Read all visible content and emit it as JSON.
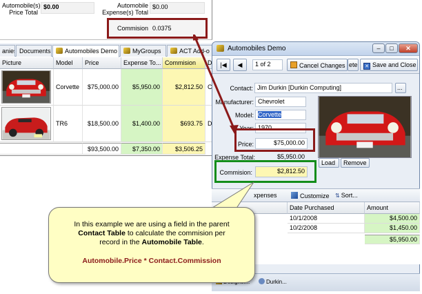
{
  "top_fields": {
    "automobile_price_total_label_1": "Automobile(s)",
    "automobile_price_total_label_2": "Price Total",
    "automobile_price_total_value": "$0.00",
    "automobile_expense_total_label_1": "Automobile",
    "automobile_expense_total_label_2": "Expense(s) Total",
    "automobile_expense_total_value": "$0.00",
    "commission_label": "Commision",
    "commission_value": "0.0375"
  },
  "tabs": [
    {
      "label": "anies"
    },
    {
      "label": "Documents"
    },
    {
      "label": "Automobiles Demo",
      "icon": "folder-icon"
    },
    {
      "label": "MyGroups",
      "icon": "folder-icon"
    },
    {
      "label": "ACT Add-o",
      "icon": "folder-icon"
    }
  ],
  "grid": {
    "columns": [
      "Picture",
      "Model",
      "Price",
      "Expense To...",
      "Commision",
      "D"
    ],
    "rows": [
      {
        "model": "Corvette",
        "price": "$75,000.00",
        "expense": "$5,950.00",
        "commission": "$2,812.50",
        "d": "C"
      },
      {
        "model": "TR6",
        "price": "$18,500.00",
        "expense": "$1,400.00",
        "commission": "$693.75",
        "d": "D"
      }
    ],
    "totals": {
      "price": "$93,500.00",
      "expense": "$7,350.00",
      "commission": "$3,506.25"
    }
  },
  "dialog": {
    "title": "Automobiles Demo",
    "record_position": "1 of 2",
    "cancel_changes": "Cancel Changes",
    "delete_label": "ete",
    "save_and_close": "Save and Close",
    "contact_label": "Contact:",
    "contact_value": "Jim Durkin [Durkin Computing]",
    "browse_label": "...",
    "manufacturer_label": "Manufacturer:",
    "manufacturer_value": "Chevrolet",
    "model_label": "Model:",
    "model_value": "Corvette",
    "year_label": "Year:",
    "year_value": "1970",
    "price_label": "Price:",
    "price_value": "$75,000.00",
    "expense_total_label": "Expense Total:",
    "expense_total_value": "$5,950.00",
    "commission_label": "Commision:",
    "commission_value": "$2,812.50",
    "load_button": "Load",
    "remove_button": "Remove",
    "expenses_button": "xpenses",
    "customize_button": "Customize",
    "sort_button": "Sort...",
    "columns": [
      "Date Purchased",
      "Amount"
    ],
    "expense_rows": [
      {
        "date": "10/1/2008",
        "amount": "$4,500.00"
      },
      {
        "date": "10/2/2008",
        "amount": "$1,450.00"
      }
    ],
    "expense_total": "$5,950.00",
    "taskbar_items": [
      "Designer...",
      "Durkin..."
    ]
  },
  "callout": {
    "line1": "In this example we are using a field in the parent",
    "bold1": "Contact Table",
    "line2": " to calculate the commision per",
    "line3": "record in the ",
    "bold2": "Automobile Table",
    "line3_end": ".",
    "formula": "Automobile.Price * Contact.Commission"
  },
  "colors": {
    "highlight_red": "#8b1a1a",
    "highlight_green": "#138d1a",
    "callout_bg": "#fffec4",
    "expense_cell": "#d6f5c4",
    "commission_cell": "#fdf7b3"
  }
}
